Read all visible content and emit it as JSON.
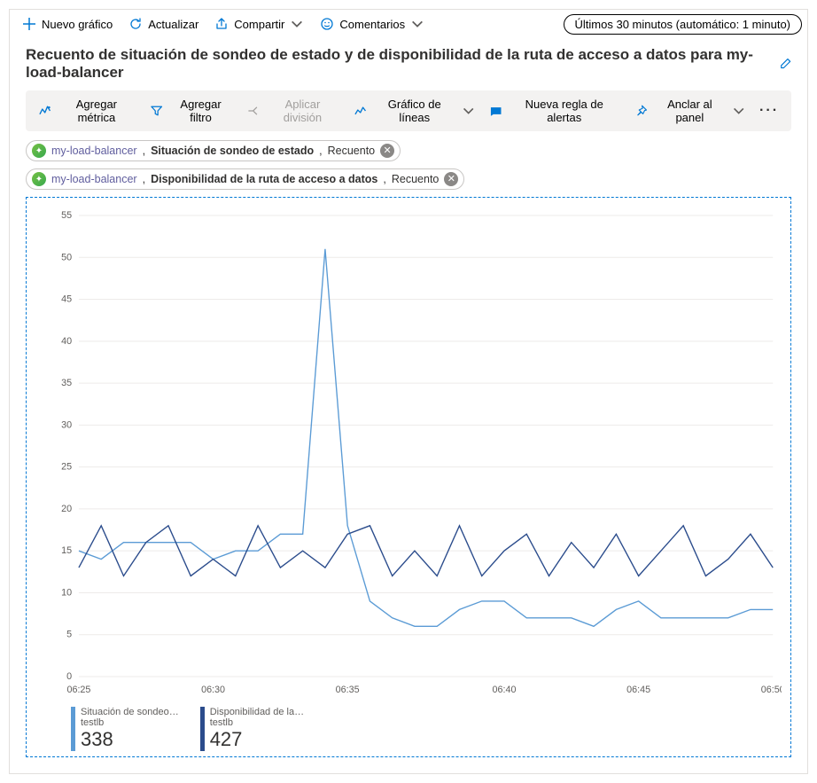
{
  "commands": {
    "new_chart": "Nuevo gráfico",
    "refresh": "Actualizar",
    "share": "Compartir",
    "comments": "Comentarios",
    "time_range": "Últimos 30 minutos (automático: 1 minuto)"
  },
  "title": "Recuento de situación de sondeo de estado y de disponibilidad de la ruta de acceso a datos para my-load-balancer",
  "toolbar": {
    "add_metric": "Agregar métrica",
    "add_filter": "Agregar filtro",
    "apply_split": "Aplicar división",
    "chart_type": "Gráfico de líneas",
    "new_alert_rule": "Nueva regla de alertas",
    "pin": "Anclar al panel"
  },
  "chips": [
    {
      "resource": "my-load-balancer",
      "metric": "Situación de sondeo de estado",
      "agg": "Recuento"
    },
    {
      "resource": "my-load-balancer",
      "metric": "Disponibilidad de la ruta de acceso a datos",
      "agg": "Recuento"
    }
  ],
  "legend": {
    "items": [
      {
        "label": "Situación de sondeo…",
        "sub": "testlb",
        "value": "338"
      },
      {
        "label": "Disponibilidad de la…",
        "sub": "testlb",
        "value": "427"
      }
    ]
  },
  "chart_data": {
    "type": "line",
    "title": "",
    "xlabel": "",
    "ylabel": "",
    "x_ticks": [
      "06:25",
      "06:30",
      "06:35",
      "06:40",
      "06:45",
      "06:50"
    ],
    "ylim": [
      0,
      55
    ],
    "x": [
      0,
      1,
      2,
      3,
      4,
      5,
      6,
      7,
      8,
      9,
      10,
      11,
      12,
      13,
      14,
      15,
      16,
      17,
      18,
      19,
      20,
      21,
      22,
      23,
      24,
      25,
      26,
      27,
      28,
      29
    ],
    "series": [
      {
        "name": "Situación de sondeo de estado (testlb)",
        "color": "#5B9BD5",
        "values": [
          15,
          14,
          16,
          16,
          16,
          16,
          14,
          15,
          15,
          17,
          17,
          51,
          18,
          9,
          7,
          6,
          6,
          8,
          9,
          9,
          7,
          7,
          7,
          6,
          8,
          9,
          7,
          7,
          7,
          7,
          8,
          8
        ]
      },
      {
        "name": "Disponibilidad de la ruta de acceso a datos (testlb)",
        "color": "#2B4C8C",
        "values": [
          13,
          18,
          12,
          16,
          18,
          12,
          14,
          12,
          18,
          13,
          15,
          13,
          17,
          18,
          12,
          15,
          12,
          18,
          12,
          15,
          17,
          12,
          16,
          13,
          17,
          12,
          15,
          18,
          12,
          14,
          17,
          13
        ]
      }
    ]
  }
}
